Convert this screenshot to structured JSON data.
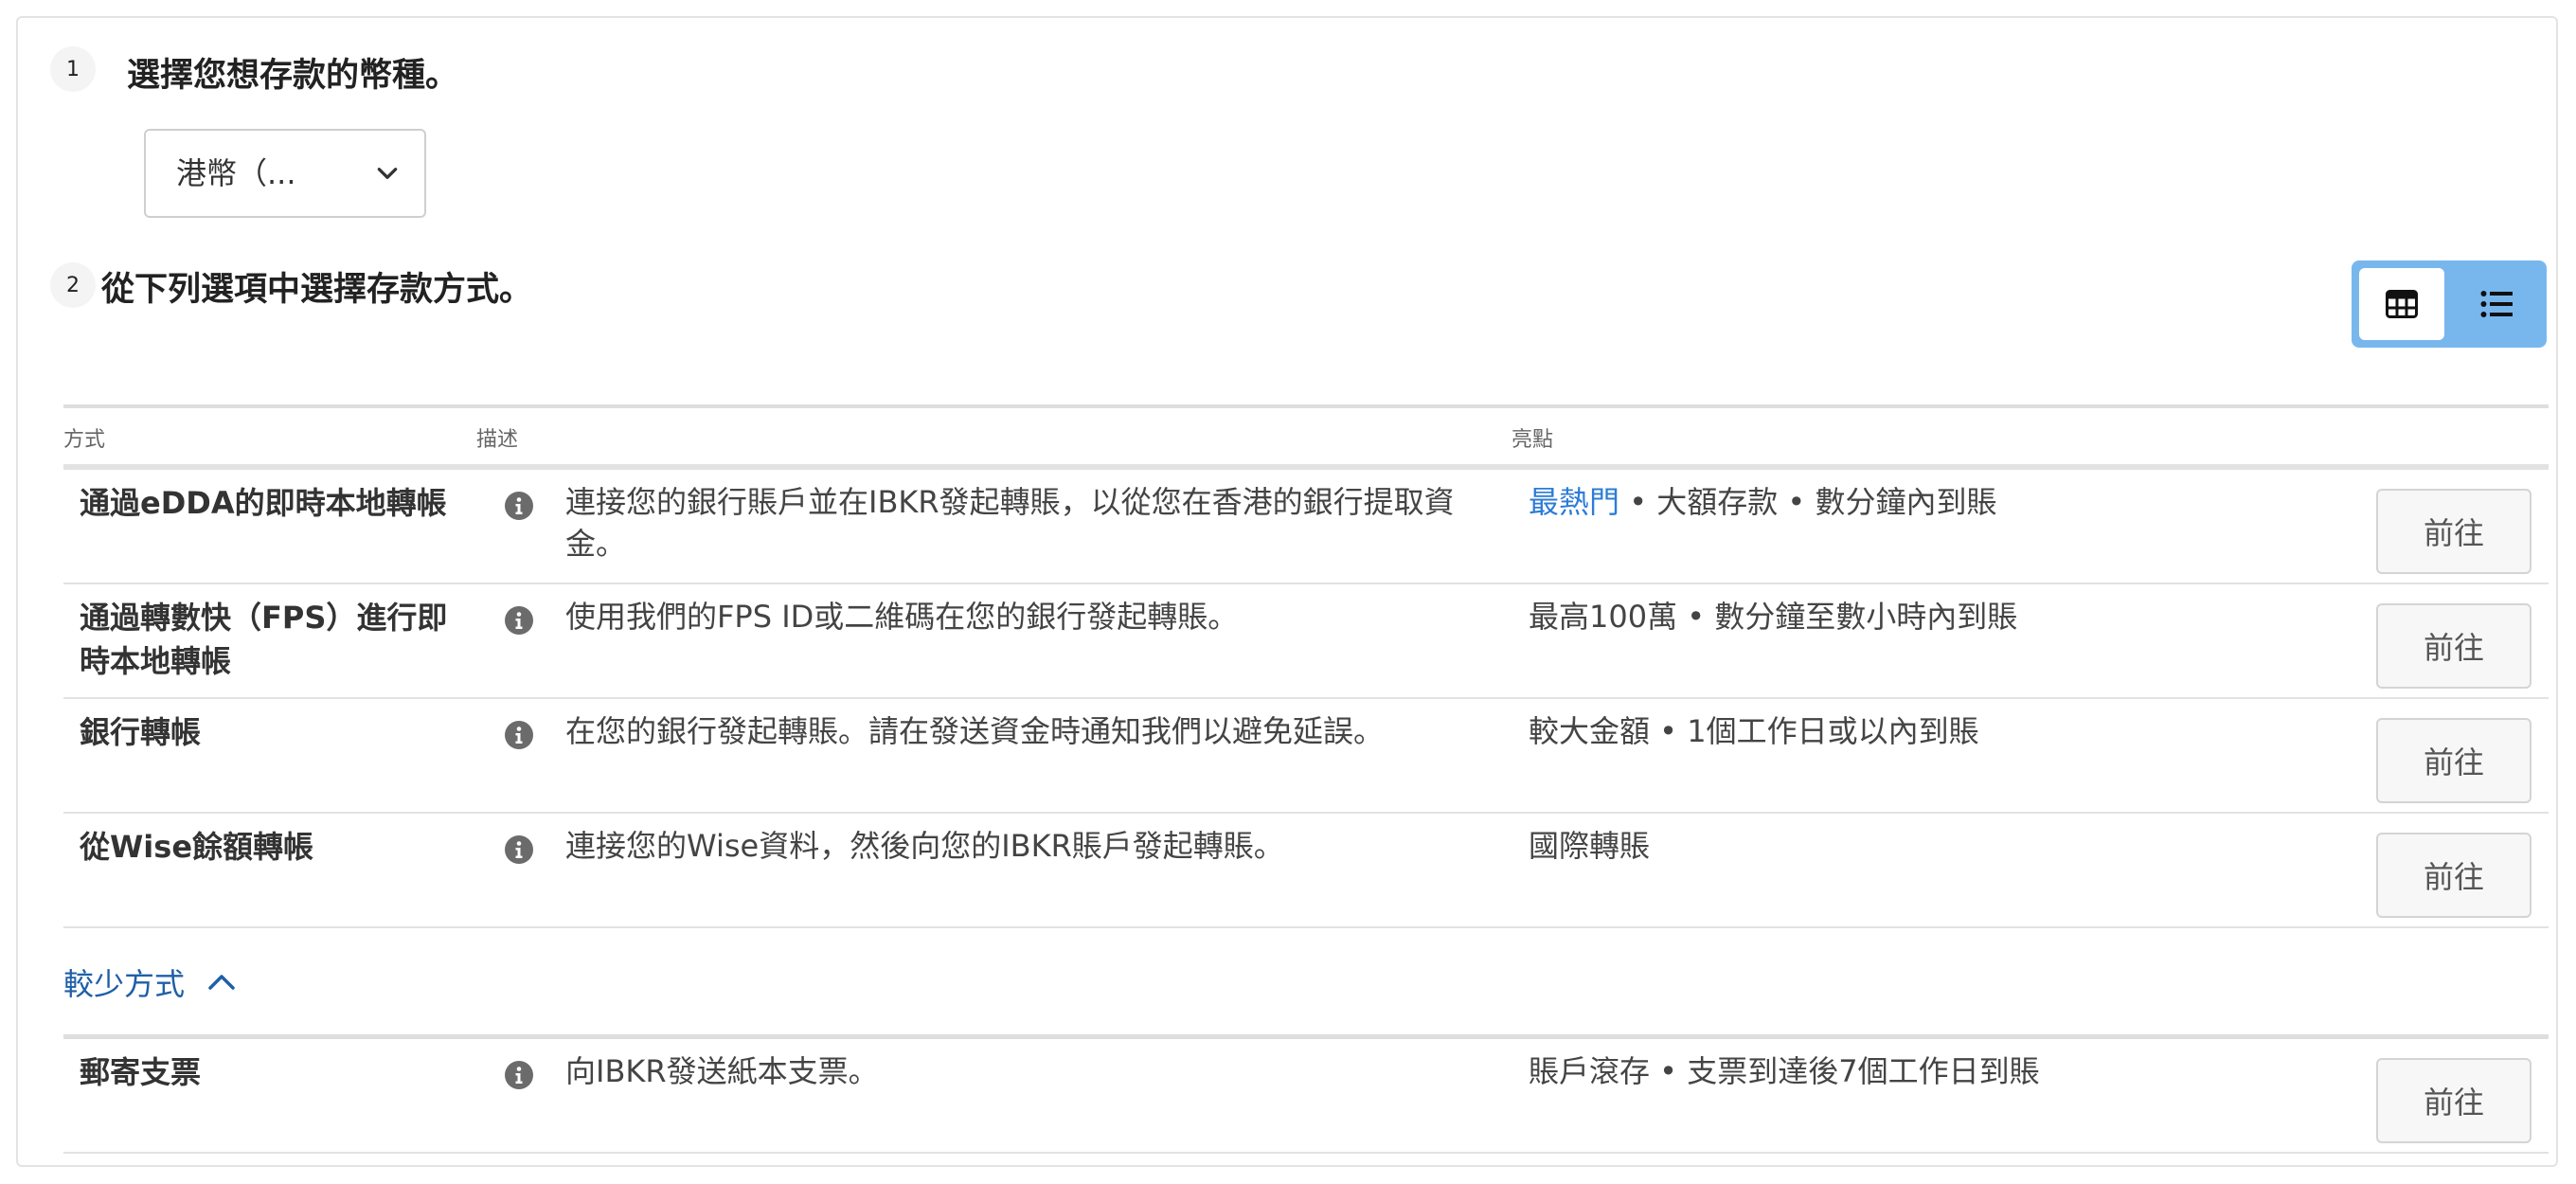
{
  "step1": {
    "number": "1",
    "title": "選擇您想存款的幣種。",
    "currency_select": {
      "value": "港幣（...",
      "icon": "chevron-down-icon"
    }
  },
  "step2": {
    "number": "2",
    "title": "從下列選項中選擇存款方式。"
  },
  "view_toggle": {
    "grid_icon": "grid-view-icon",
    "list_icon": "list-view-icon",
    "active": "grid"
  },
  "table": {
    "headers": {
      "method": "方式",
      "description": "描述",
      "highlights": "亮點"
    },
    "rows": [
      {
        "method": "通過eDDA的即時本地轉帳",
        "description": "連接您的銀行賬戶並在IBKR發起轉賬，以從您在香港的銀行提取資金。",
        "highlight_hot": "最熱門",
        "highlights": " • 大額存款 • 數分鐘內到賬",
        "button": "前往"
      },
      {
        "method": "通過轉數快（FPS）進行即時本地轉帳",
        "description": "使用我們的FPS ID或二維碼在您的銀行發起轉賬。",
        "highlights": "最高100萬 • 數分鐘至數小時內到賬",
        "button": "前往"
      },
      {
        "method": "銀行轉帳",
        "description": "在您的銀行發起轉賬。請在發送資金時通知我們以避免延誤。",
        "highlights": "較大金額 • 1個工作日或以內到賬",
        "button": "前往"
      },
      {
        "method": "從Wise餘額轉帳",
        "description": "連接您的Wise資料，然後向您的IBKR賬戶發起轉賬。",
        "highlights": "國際轉賬",
        "button": "前往"
      }
    ],
    "less_methods": {
      "label": "較少方式",
      "icon": "chevron-up-icon"
    },
    "extra_rows": [
      {
        "method": "郵寄支票",
        "description": "向IBKR發送紙本支票。",
        "highlights": "賬戶滾存 • 支票到達後7個工作日到賬",
        "button": "前往"
      }
    ]
  },
  "colors": {
    "accent_blue": "#2d7cd6",
    "toggle_bg": "#78b7ee",
    "link": "#1f5fa8"
  }
}
